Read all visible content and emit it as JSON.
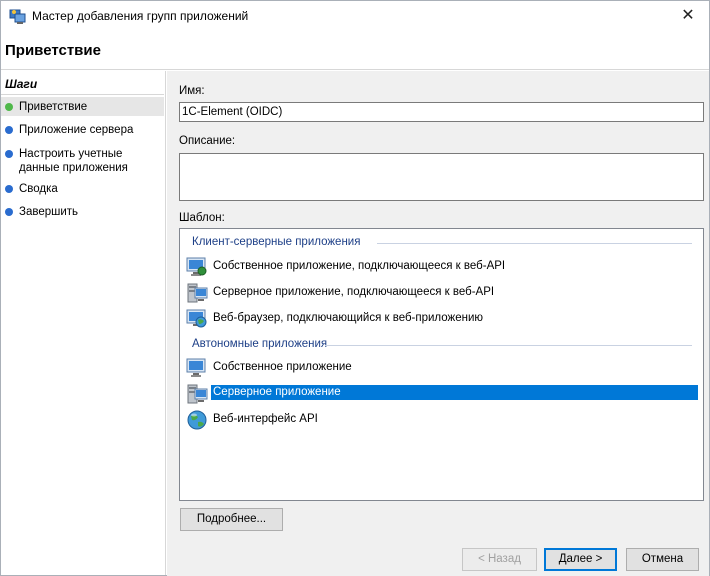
{
  "window": {
    "title": "Мастер добавления групп приложений",
    "close_glyph": "✕"
  },
  "header": {
    "title": "Приветствие"
  },
  "steps": {
    "title": "Шаги",
    "items": [
      {
        "label": "Приветствие",
        "state": "active"
      },
      {
        "label": "Приложение сервера",
        "state": "pending"
      },
      {
        "label": "Настроить учетные данные приложения",
        "state": "pending"
      },
      {
        "label": "Сводка",
        "state": "pending"
      },
      {
        "label": "Завершить",
        "state": "pending"
      }
    ]
  },
  "form": {
    "name_label": "Имя:",
    "name_value": "1C-Element (OIDC)",
    "description_label": "Описание:",
    "description_value": "",
    "template_label": "Шаблон:"
  },
  "templates": {
    "groups": [
      {
        "title": "Клиент-серверные приложения",
        "items": [
          {
            "label": "Собственное приложение, подключающееся к веб-API",
            "icon": "native-app-icon"
          },
          {
            "label": "Серверное приложение, подключающееся к веб-API",
            "icon": "server-app-icon"
          },
          {
            "label": "Веб-браузер, подключающийся к веб-приложению",
            "icon": "browser-app-icon"
          }
        ]
      },
      {
        "title": "Автономные приложения",
        "items": [
          {
            "label": "Собственное приложение",
            "icon": "native-app-icon"
          },
          {
            "label": "Серверное приложение",
            "icon": "server-app-icon",
            "selected": true
          },
          {
            "label": "Веб-интерфейс API",
            "icon": "globe-icon"
          }
        ]
      }
    ]
  },
  "buttons": {
    "more": "Подробнее...",
    "back": "< Назад",
    "next": "Далее >",
    "cancel": "Отмена"
  },
  "colors": {
    "selection": "#0078d7",
    "group_header": "#1d3f87",
    "active_step_dot": "#4fb84a",
    "step_dot": "#2a6ccf"
  }
}
